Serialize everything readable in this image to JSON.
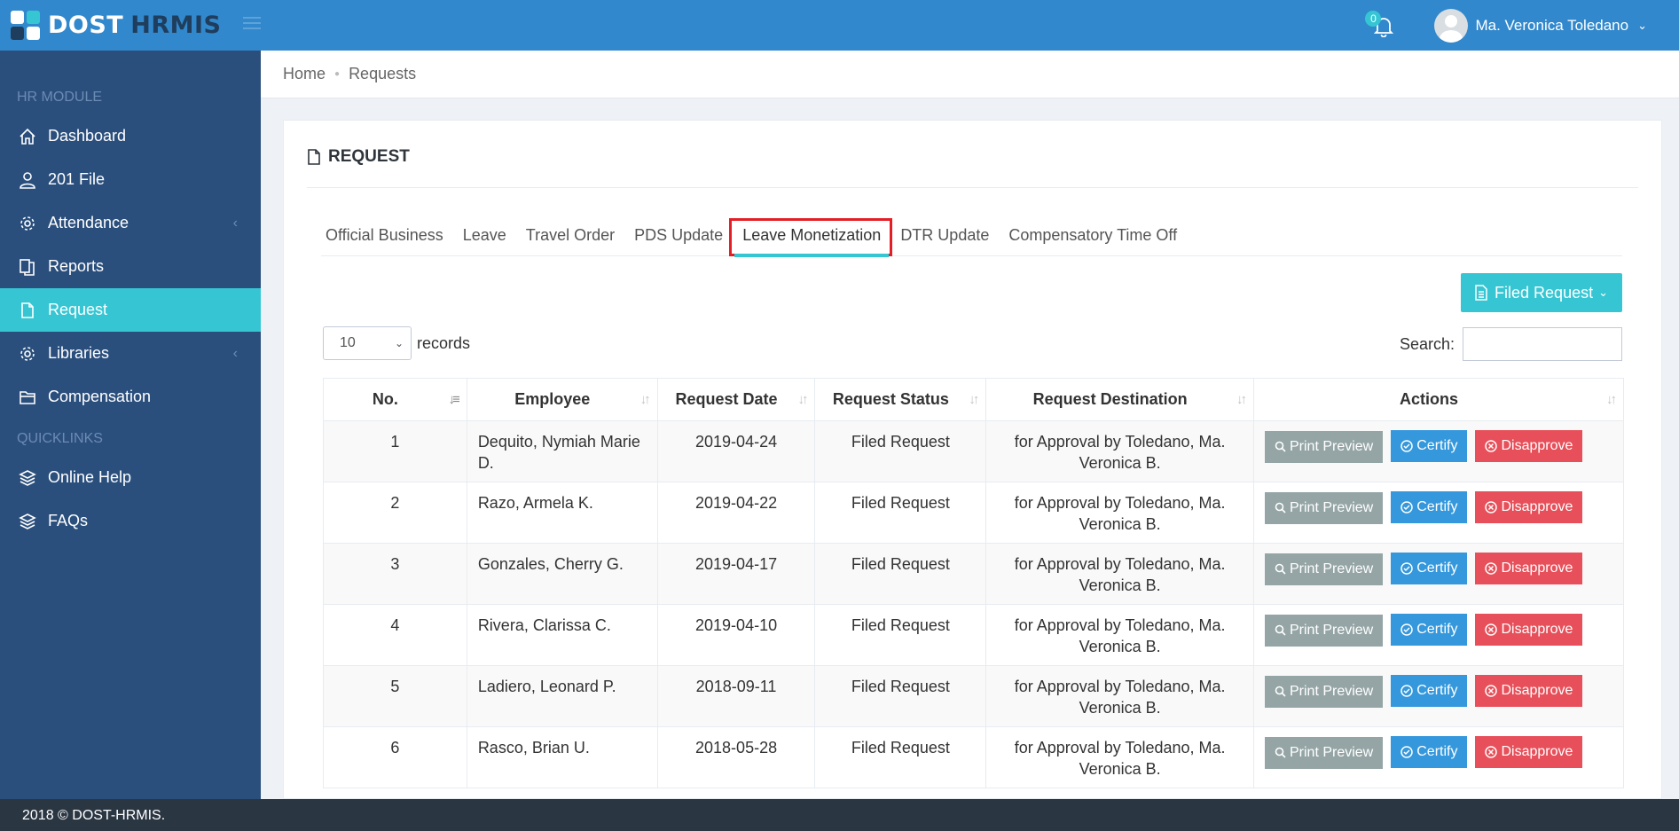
{
  "app": {
    "brand_part1": "DOST",
    "brand_part2": "HRMIS",
    "notification_count": "0",
    "user_name": "Ma. Veronica Toledano"
  },
  "sidebar": {
    "section1": "HR MODULE",
    "section2": "QUICKLINKS",
    "items": [
      {
        "label": "Dashboard",
        "icon": "home-icon"
      },
      {
        "label": "201 File",
        "icon": "user-icon"
      },
      {
        "label": "Attendance",
        "icon": "gear-icon"
      },
      {
        "label": "Reports",
        "icon": "documents-icon"
      },
      {
        "label": "Request",
        "icon": "file-icon"
      },
      {
        "label": "Libraries",
        "icon": "gear-icon"
      },
      {
        "label": "Compensation",
        "icon": "folder-icon"
      }
    ],
    "quicklinks": [
      {
        "label": "Online Help",
        "icon": "layers-icon"
      },
      {
        "label": "FAQs",
        "icon": "layers-icon"
      }
    ]
  },
  "breadcrumb": {
    "home": "Home",
    "current": "Requests"
  },
  "card": {
    "title": "REQUEST"
  },
  "tabs": [
    "Official Business",
    "Leave",
    "Travel Order",
    "PDS Update",
    "Leave Monetization",
    "DTR Update",
    "Compensatory Time Off"
  ],
  "filter_button": "Filed Request",
  "records": {
    "page_size": "10",
    "label": "records"
  },
  "search": {
    "label": "Search:",
    "value": ""
  },
  "table": {
    "headers": [
      "No.",
      "Employee",
      "Request Date",
      "Request Status",
      "Request Destination",
      "Actions"
    ],
    "rows": [
      {
        "no": "1",
        "employee": "Dequito, Nymiah Marie D.",
        "date": "2019-04-24",
        "status": "Filed Request",
        "destination": "for Approval by Toledano, Ma. Veronica B."
      },
      {
        "no": "2",
        "employee": "Razo, Armela K.",
        "date": "2019-04-22",
        "status": "Filed Request",
        "destination": "for Approval by Toledano, Ma. Veronica B."
      },
      {
        "no": "3",
        "employee": "Gonzales, Cherry G.",
        "date": "2019-04-17",
        "status": "Filed Request",
        "destination": "for Approval by Toledano, Ma. Veronica B."
      },
      {
        "no": "4",
        "employee": "Rivera, Clarissa C.",
        "date": "2019-04-10",
        "status": "Filed Request",
        "destination": "for Approval by Toledano, Ma. Veronica B."
      },
      {
        "no": "5",
        "employee": "Ladiero, Leonard P.",
        "date": "2018-09-11",
        "status": "Filed Request",
        "destination": "for Approval by Toledano, Ma. Veronica B."
      },
      {
        "no": "6",
        "employee": "Rasco, Brian U.",
        "date": "2018-05-28",
        "status": "Filed Request",
        "destination": "for Approval by Toledano, Ma. Veronica B."
      }
    ],
    "actions": {
      "print": "Print Preview",
      "certify": "Certify",
      "disapprove": "Disapprove"
    }
  },
  "footer": {
    "text": "2018 © DOST-HRMIS."
  }
}
